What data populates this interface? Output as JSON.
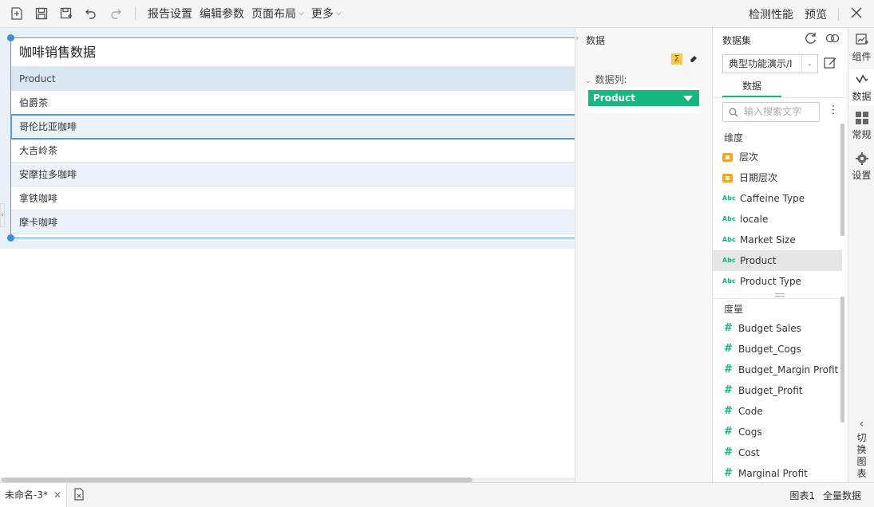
{
  "toolbar": {
    "icons": [
      "new-report-icon",
      "save-icon",
      "save-as-icon",
      "undo-icon",
      "redo-icon"
    ],
    "menus": [
      {
        "label": "报告设置",
        "has_caret": false
      },
      {
        "label": "编辑参数",
        "has_caret": false
      },
      {
        "label": "页面布局",
        "has_caret": true
      },
      {
        "label": "更多",
        "has_caret": true
      }
    ],
    "right": {
      "performance": "检测性能",
      "preview": "预览"
    }
  },
  "widget": {
    "title": "咖啡销售数据",
    "header": "Product",
    "rows": [
      "伯爵茶",
      "哥伦比亚咖啡",
      "大吉岭茶",
      "安摩拉多咖啡",
      "拿铁咖啡",
      "摩卡咖啡"
    ]
  },
  "data_config": {
    "title": "数据",
    "columns_label": "数据列:",
    "column_pill": "Product",
    "sigma": "Σ"
  },
  "dataset": {
    "title": "数据集",
    "selected": "典型功能演示/I",
    "tab": "数据",
    "search_placeholder": "输入搜索文字",
    "dimension_label": "维度",
    "dimensions": [
      {
        "type": "folder",
        "label": "层次"
      },
      {
        "type": "folder",
        "label": "日期层次"
      },
      {
        "type": "text",
        "label": "Caffeine Type"
      },
      {
        "type": "text",
        "label": "locale"
      },
      {
        "type": "text",
        "label": "Market Size"
      },
      {
        "type": "text",
        "label": "Product",
        "active": true
      },
      {
        "type": "text",
        "label": "Product Type"
      }
    ],
    "measure_label": "度量",
    "measures": [
      "Budget Sales",
      "Budget_Cogs",
      "Budget_Margin Profit",
      "Budget_Profit",
      "Code",
      "Cogs",
      "Cost",
      "Marginal Profit"
    ],
    "abc": "Abc",
    "hash": "#"
  },
  "sidebar": {
    "items": [
      {
        "label": "组件",
        "icon": "component-icon"
      },
      {
        "label": "数据",
        "icon": "data-icon",
        "active": true
      },
      {
        "label": "常规",
        "icon": "general-icon"
      },
      {
        "label": "设置",
        "icon": "settings-icon"
      }
    ],
    "switch_label": [
      "切",
      "换",
      "图",
      "表"
    ]
  },
  "statusbar": {
    "tab": "未命名-3*",
    "chart": "图表1",
    "all_data": "全量数据"
  }
}
